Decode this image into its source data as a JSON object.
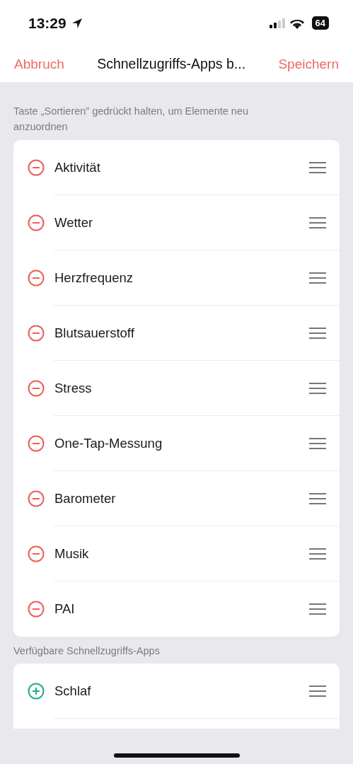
{
  "status_bar": {
    "time": "13:29",
    "battery": "64"
  },
  "nav": {
    "cancel": "Abbruch",
    "title": "Schnellzugriffs-Apps b...",
    "save": "Speichern"
  },
  "hint": "Taste „Sortieren” gedrückt halten, um Elemente neu anzuordnen",
  "active_apps": [
    {
      "label": "Aktivität",
      "kind": "remove"
    },
    {
      "label": "Wetter",
      "kind": "remove"
    },
    {
      "label": "Herzfrequenz",
      "kind": "remove"
    },
    {
      "label": "Blutsauerstoff",
      "kind": "remove"
    },
    {
      "label": "Stress",
      "kind": "remove"
    },
    {
      "label": "One-Tap-Messung",
      "kind": "remove"
    },
    {
      "label": "Barometer",
      "kind": "remove"
    },
    {
      "label": "Musik",
      "kind": "remove"
    },
    {
      "label": "PAI",
      "kind": "remove"
    }
  ],
  "available_title": "Verfügbare Schnellzugriffs-Apps",
  "available_apps": [
    {
      "label": "Schlaf",
      "kind": "add"
    }
  ]
}
